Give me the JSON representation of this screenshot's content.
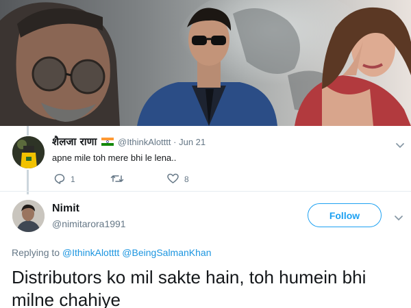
{
  "poster": {
    "description_icon": "movie-poster-image"
  },
  "parent_tweet": {
    "author_name": "शैलजा राणा",
    "author_flag_icon": "india-flag-icon",
    "handle": "@IthinkAlotttt",
    "separator": "·",
    "date": "Jun 21",
    "text": "apne mile toh mere bhi le lena..",
    "reply_count": "1",
    "retweet_count": "",
    "like_count": "8",
    "menu_icon": "chevron-down-icon"
  },
  "reply_tweet": {
    "author_name": "Nimit",
    "handle": "@nimitarora1991",
    "follow_label": "Follow",
    "menu_icon": "chevron-down-icon",
    "replying_prefix": "Replying to",
    "mentions": [
      "@IthinkAlotttt",
      "@BeingSalmanKhan"
    ],
    "text": "Distributors ko mil sakte hain, toh humein bhi milne chahiye"
  },
  "colors": {
    "link_blue": "#1b95e0",
    "follow_blue": "#1da1f2",
    "muted_gray": "#657786",
    "text_dark": "#14171a"
  }
}
